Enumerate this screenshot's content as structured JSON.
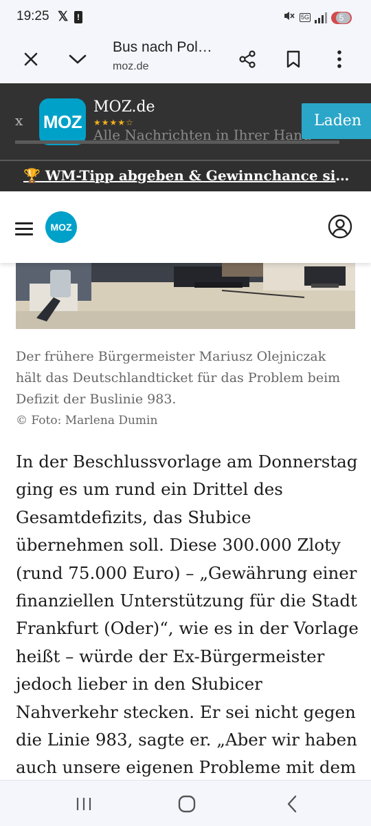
{
  "status_bar": {
    "time": "19:25",
    "x_app": "𝕏",
    "alert": "!",
    "network": "5G",
    "battery": "5"
  },
  "browser": {
    "page_title": "Bus nach Pol…",
    "url": "moz.de",
    "icons": [
      "close-icon",
      "chevron-down-icon",
      "share-icon",
      "bookmark-icon",
      "more-vert-icon"
    ]
  },
  "app_banner": {
    "close": "x",
    "logo_text": "MOZ",
    "app_name": "MOZ.de",
    "stars": "★★★★☆",
    "tagline": "Alle Nachrichten in Ihrer Hand",
    "button": "Laden"
  },
  "promo": {
    "text": "🏆 WM-Tipp abgeben & Gewinnchance sichern!"
  },
  "site_header": {
    "logo_text": "MOZ",
    "icons": [
      "menu-icon",
      "user-account-icon"
    ]
  },
  "article": {
    "caption": "Der frühere Bürgermeister Mariusz Olejniczak hält das Deutschlandticket für das Problem beim Defizit der Buslinie 983.",
    "credit": "© Foto: Marlena Dumin",
    "body": "In der Beschlussvorlage am Donnerstag ging es um rund ein Drittel des Gesamtdefizits, das Słubice übernehmen soll. Diese 300.000 Zloty (rund 75.000 Euro) – „Gewährung einer finanziellen Unterstützung für die Stadt Frankfurt (Oder)“, wie es in der Vorlage heißt – würde der Ex-Bürgermeister jedoch lieber in den Słubicer Nahverkehr stecken. Er sei nicht gegen die Linie 983, sagte er. „Aber wir haben auch unsere eigenen Probleme mit dem lokalen"
  },
  "nav_bar": {
    "icons": [
      "recent-apps-icon",
      "home-icon",
      "back-icon"
    ]
  },
  "colors": {
    "brand": "#00a1c9",
    "banner_bg": "#323232",
    "promo_bg": "#2f2f2f",
    "chrome_bg": "#f4f6fb"
  }
}
